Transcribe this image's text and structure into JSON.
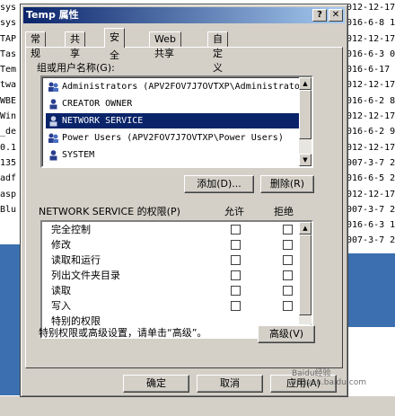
{
  "background": {
    "left_items": [
      "sys",
      "sys",
      "TAP",
      "Tas",
      "Tem",
      "twa",
      "WBE",
      "Win",
      "_de",
      "0.1",
      "135",
      "adf",
      "asp",
      "Blu"
    ],
    "right_dates": [
      "012-12-17",
      "016-6-8 1",
      "012-12-17",
      "016-6-3 0",
      "016-6-17",
      "012-12-17",
      "016-6-2 8",
      "012-12-17",
      "016-6-2 9",
      "012-12-17",
      "007-3-7 2",
      "016-6-5 2",
      "012-12-17",
      "007-3-7 2",
      "016-6-3 1",
      "007-3-7 2"
    ]
  },
  "dialog": {
    "title": "Temp 属性",
    "help_glyph": "?",
    "close_glyph": "✕",
    "tabs": [
      "常规",
      "共享",
      "安全",
      "Web 共享",
      "自定义"
    ],
    "active_tab": "安全",
    "group_label": "组或用户名称(G):",
    "users": [
      {
        "name": "Administrators (APV2FOV7J7OVTXP\\Administrators)",
        "selected": false
      },
      {
        "name": "CREATOR OWNER",
        "selected": false
      },
      {
        "name": "NETWORK SERVICE",
        "selected": true
      },
      {
        "name": "Power Users (APV2FOV7J7OVTXP\\Power Users)",
        "selected": false
      },
      {
        "name": "SYSTEM",
        "selected": false
      }
    ],
    "add_button": "添加(D)...",
    "remove_button": "删除(R)",
    "perm_label": "NETWORK SERVICE 的权限(P)",
    "allow_header": "允许",
    "deny_header": "拒绝",
    "permissions": [
      "完全控制",
      "修改",
      "读取和运行",
      "列出文件夹目录",
      "读取",
      "写入",
      "特别的权限"
    ],
    "advanced_text": "特别权限或高级设置，请单击“高级”。",
    "advanced_button": "高级(V)",
    "ok_button": "确定",
    "cancel_button": "取消",
    "apply_button": "应用(A)"
  },
  "watermark": "jingyan.baidu.com",
  "watermark_brand": "Baidu经验"
}
